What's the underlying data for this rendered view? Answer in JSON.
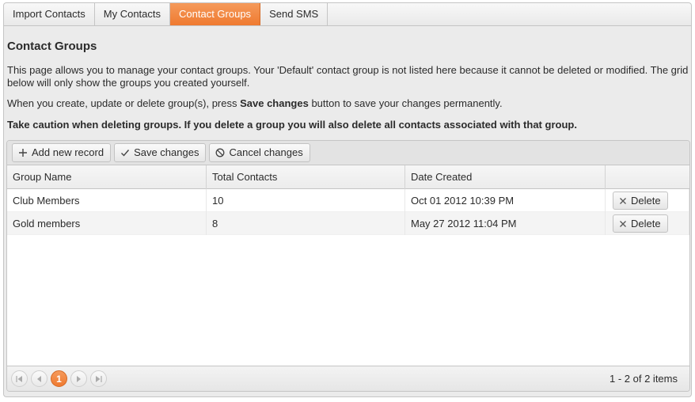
{
  "tabs": [
    {
      "label": "Import Contacts",
      "active": false
    },
    {
      "label": "My Contacts",
      "active": false
    },
    {
      "label": "Contact Groups",
      "active": true
    },
    {
      "label": "Send SMS",
      "active": false
    }
  ],
  "page": {
    "title": "Contact Groups",
    "para1": "This page allows you to manage your contact groups. Your 'Default' contact group is not listed here because it cannot be deleted or modified. The grid below will only show the groups you created yourself.",
    "para2_before": "When you create, update or delete group(s), press ",
    "para2_bold": "Save changes",
    "para2_after": " button to save your changes permanently.",
    "warning": "Take caution when deleting groups. If you delete a group you will also delete all contacts associated with that group."
  },
  "toolbar": {
    "add_label": "Add new record",
    "save_label": "Save changes",
    "cancel_label": "Cancel changes"
  },
  "grid": {
    "columns": [
      "Group Name",
      "Total Contacts",
      "Date Created",
      ""
    ],
    "rows": [
      {
        "name": "Club Members",
        "total": "10",
        "date": "Oct 01 2012 10:39 PM",
        "delete_label": "Delete"
      },
      {
        "name": "Gold members",
        "total": "8",
        "date": "May 27 2012 11:04 PM",
        "delete_label": "Delete"
      }
    ]
  },
  "pager": {
    "current_page": "1",
    "info": "1 - 2 of 2 items"
  },
  "colors": {
    "accent": "#ef7a30",
    "panel": "#ebebeb"
  }
}
